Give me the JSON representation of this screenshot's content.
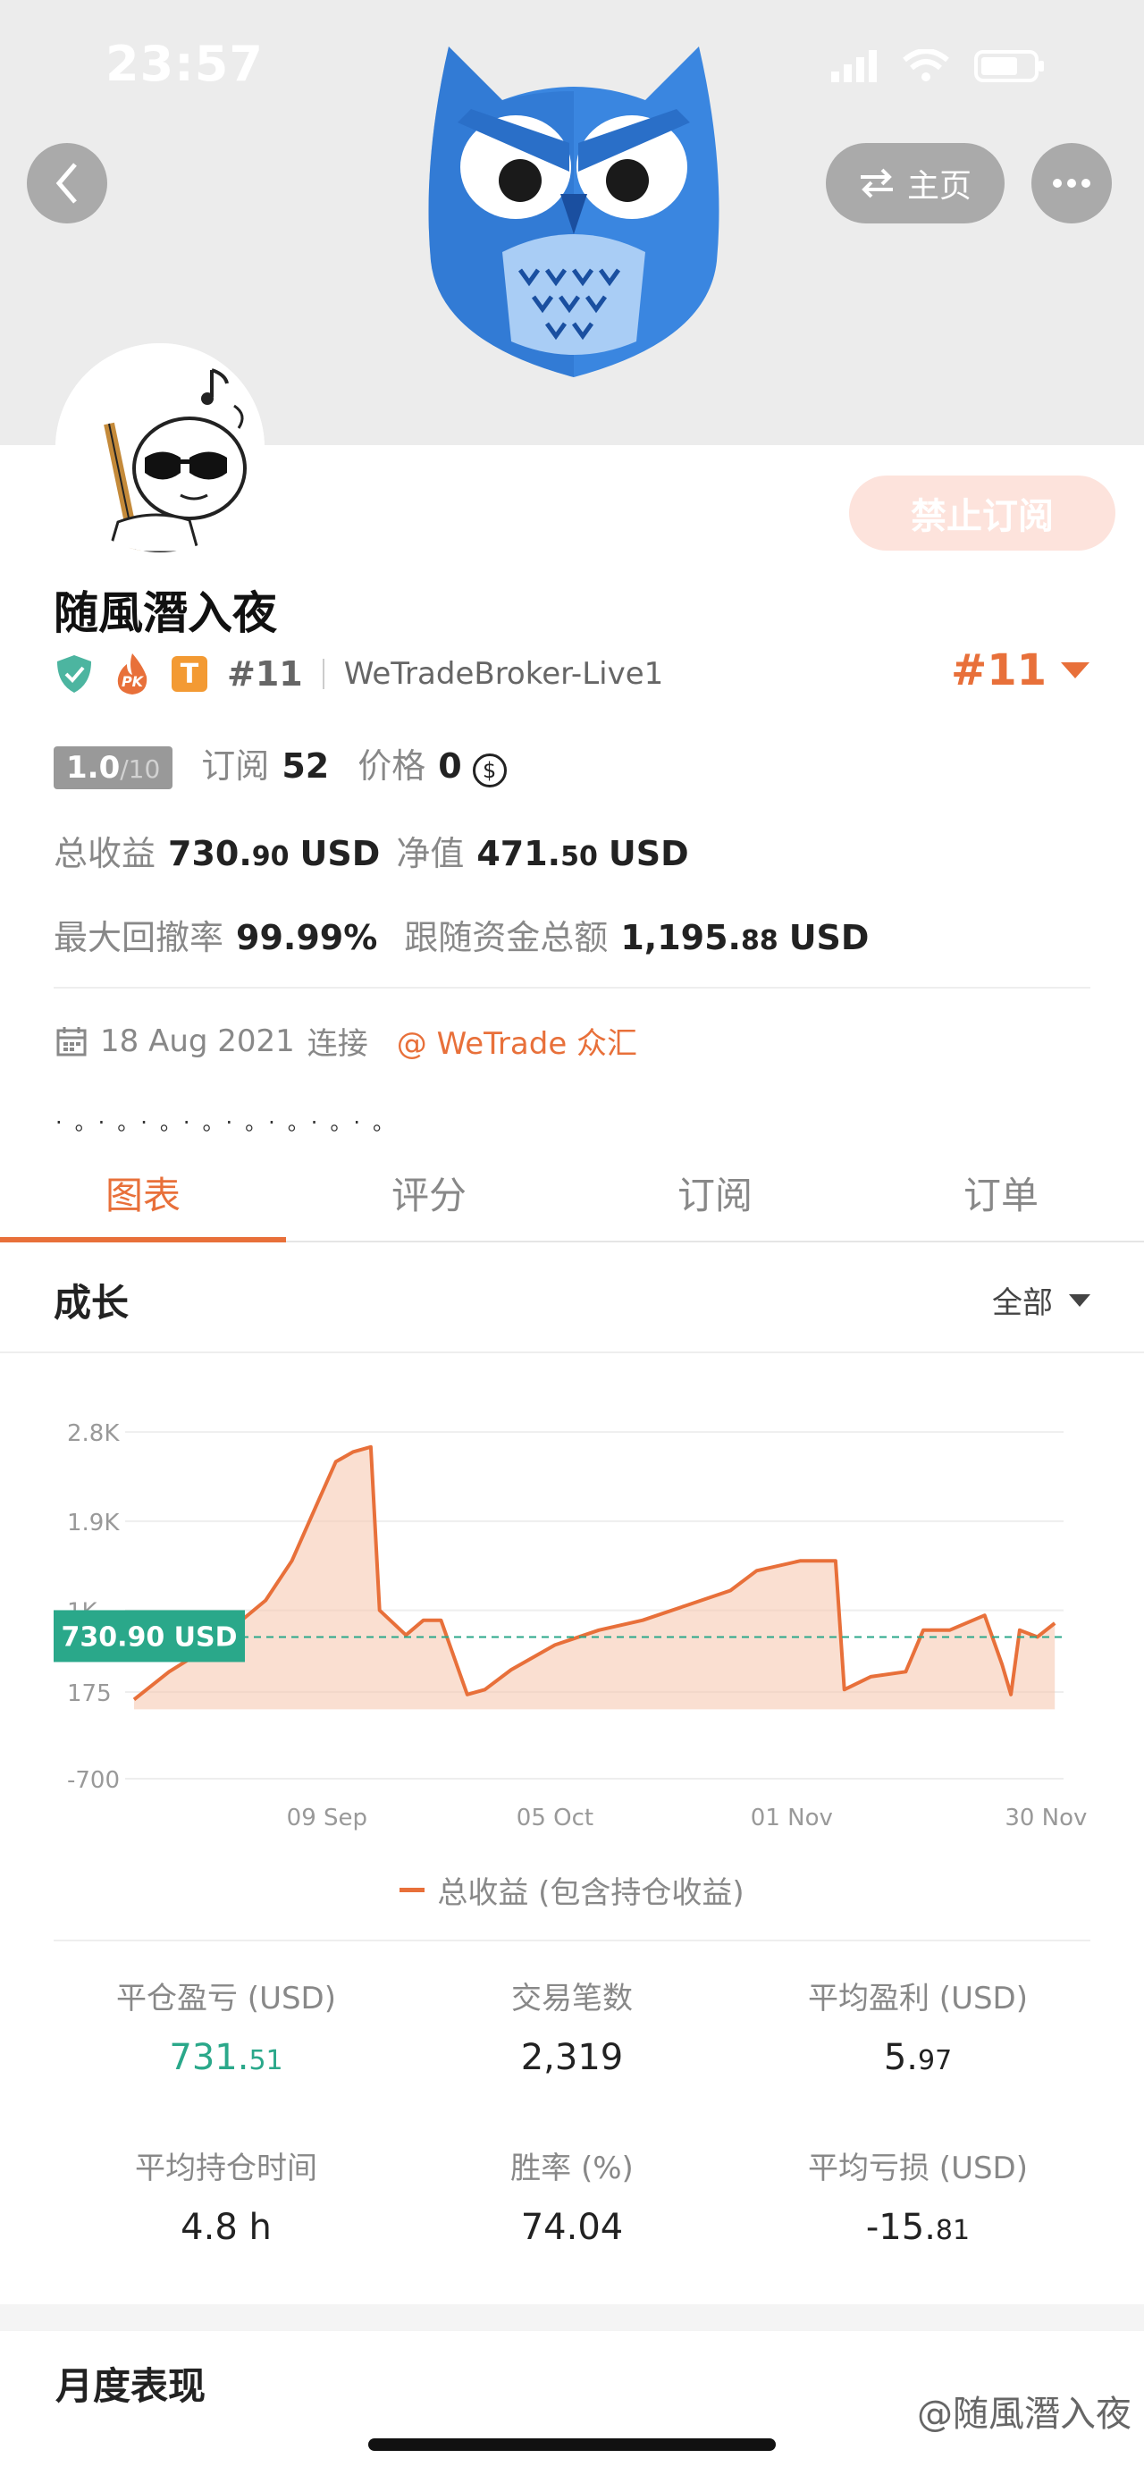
{
  "status_bar": {
    "time": "23:57"
  },
  "header": {
    "home_label": "主页"
  },
  "profile": {
    "subscribe_disabled_label": "禁止订阅",
    "name": "随風潛入夜",
    "badge_pk": "PK",
    "badge_t": "T",
    "rank_small": "#11",
    "broker": "WeTradeBroker-Live1",
    "rank_big": "#11",
    "score_value": "1.0",
    "score_max": "/10",
    "subscriptions_label": "订阅",
    "subscriptions_value": "52",
    "price_label": "价格",
    "price_value": "0",
    "total_profit_label": "总收益",
    "total_profit_int": "730.",
    "total_profit_dec": "90",
    "total_profit_unit": "USD",
    "equity_label": "净值",
    "equity_int": "471.",
    "equity_dec": "50",
    "equity_unit": "USD",
    "max_drawdown_label": "最大回撤率",
    "max_drawdown_value": "99.99%",
    "follow_funds_label": "跟随资金总额",
    "follow_funds_int": "1,195.",
    "follow_funds_dec": "88",
    "follow_funds_unit": "USD",
    "connected_date": "18 Aug 2021",
    "connected_label": "连接",
    "community": "@ WeTrade 众汇",
    "bio": "·。·。·。·。·。·。·。·。"
  },
  "tabs": [
    {
      "label": "图表",
      "active": true
    },
    {
      "label": "评分",
      "active": false
    },
    {
      "label": "订阅",
      "active": false
    },
    {
      "label": "订单",
      "active": false
    }
  ],
  "growth": {
    "title": "成长",
    "range": "全部"
  },
  "chart_data": {
    "type": "area",
    "series": [
      {
        "name": "总收益 (包含持仓收益)",
        "x": [
          "2021-08-18",
          "2021-08-22",
          "2021-08-26",
          "2021-08-30",
          "2021-09-02",
          "2021-09-05",
          "2021-09-08",
          "2021-09-10",
          "2021-09-12",
          "2021-09-14",
          "2021-09-15",
          "2021-09-18",
          "2021-09-20",
          "2021-09-22",
          "2021-09-25",
          "2021-09-27",
          "2021-09-30",
          "2021-10-05",
          "2021-10-10",
          "2021-10-15",
          "2021-10-20",
          "2021-10-25",
          "2021-10-28",
          "2021-11-02",
          "2021-11-06",
          "2021-11-07",
          "2021-11-10",
          "2021-11-14",
          "2021-11-16",
          "2021-11-19",
          "2021-11-23",
          "2021-11-25",
          "2021-11-26",
          "2021-11-27",
          "2021-11-29",
          "2021-12-01"
        ],
        "y": [
          100,
          380,
          600,
          880,
          1100,
          1500,
          2100,
          2500,
          2600,
          2650,
          1000,
          750,
          900,
          900,
          150,
          200,
          400,
          650,
          800,
          900,
          1050,
          1200,
          1400,
          1500,
          1500,
          200,
          330,
          380,
          800,
          800,
          950,
          450,
          150,
          800,
          730.9,
          870
        ]
      }
    ],
    "current_value_label": "730.90 USD",
    "current_value": 730.9,
    "y_ticks": [
      "2.8K",
      "1.9K",
      "1K",
      "175",
      "-700"
    ],
    "y_tick_values": [
      2800,
      1900,
      1000,
      175,
      -700
    ],
    "x_ticks": [
      "09 Sep",
      "05 Oct",
      "01 Nov",
      "30 Nov"
    ],
    "x_tick_dates": [
      "2021-09-09",
      "2021-10-05",
      "2021-11-01",
      "2021-11-30"
    ],
    "x_range": [
      "2021-08-18",
      "2021-12-02"
    ],
    "ylim": [
      -700,
      3000
    ],
    "grid": true,
    "legend": "bottom-center"
  },
  "stats": [
    {
      "label": "平仓盈亏 (USD)",
      "int": "731.",
      "dec": "51",
      "green": true
    },
    {
      "label": "交易笔数",
      "int": "2,319",
      "dec": ""
    },
    {
      "label": "平均盈利 (USD)",
      "int": "5.",
      "dec": "97"
    },
    {
      "label": "平均持仓时间",
      "int": "4.8 h",
      "dec": ""
    },
    {
      "label": "胜率 (%)",
      "int": "74.04",
      "dec": ""
    },
    {
      "label": "平均亏损 (USD)",
      "int": "-15.",
      "dec": "81"
    }
  ],
  "monthly": {
    "title": "月度表现"
  },
  "watermark": "@随風潛入夜",
  "colors": {
    "accent": "#e8703a",
    "green": "#2aa88a",
    "owl_blue": "#3a86e0"
  }
}
